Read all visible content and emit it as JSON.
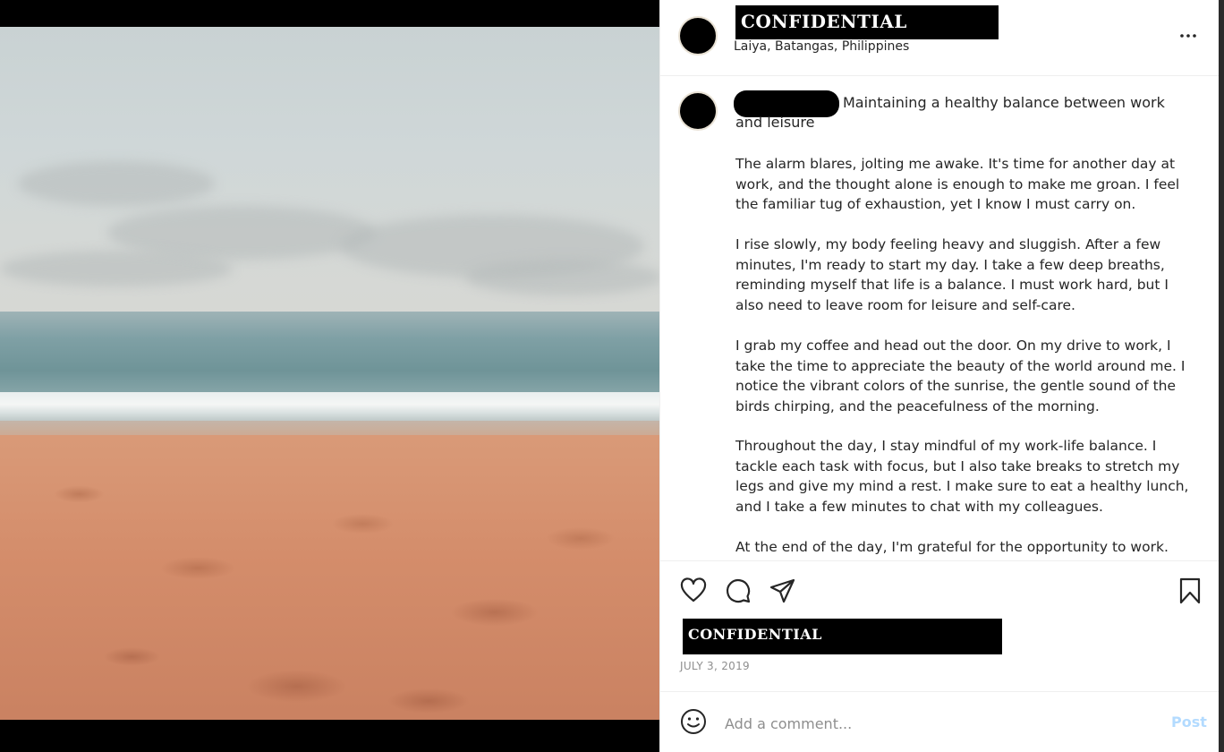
{
  "post": {
    "username_redaction": "CONFIDENTIAL",
    "location": "Laiya, Batangas, Philippines",
    "caption_title": "Maintaining a healthy balance between work and leisure",
    "paragraphs": [
      "The alarm blares, jolting me awake. It's time for another day at work, and the thought alone is enough to make me groan. I feel the familiar tug of exhaustion, yet I know I must carry on.",
      "I rise slowly, my body feeling heavy and sluggish. After a few minutes, I'm ready to start my day. I take a few deep breaths, reminding myself that life is a balance. I must work hard, but I also need to leave room for leisure and self-care.",
      "I grab my coffee and head out the door. On my drive to work, I take the time to appreciate the beauty of the world around me. I notice the vibrant colors of the sunrise, the gentle sound of the birds chirping, and the peacefulness of the morning.",
      "Throughout the day, I stay mindful of my work-life balance. I tackle each task with focus, but I also take breaks to stretch my legs and give my mind a rest. I make sure to eat a healthy lunch, and I take a few minutes to chat with my colleagues.",
      "At the end of the day, I'm grateful for the opportunity to work."
    ],
    "likes_redaction": "CONFIDENTIAL",
    "date": "JULY 3, 2019"
  },
  "icons": {
    "more": "more-horizontal-icon",
    "like": "heart-icon",
    "comment": "comment-icon",
    "share": "send-icon",
    "save": "bookmark-icon",
    "emoji": "emoji-icon"
  },
  "comment": {
    "placeholder": "Add a comment...",
    "post_label": "Post"
  },
  "colors": {
    "post_button_disabled": "#b3dbff",
    "text": "#262626",
    "muted": "#8e8e8e"
  }
}
